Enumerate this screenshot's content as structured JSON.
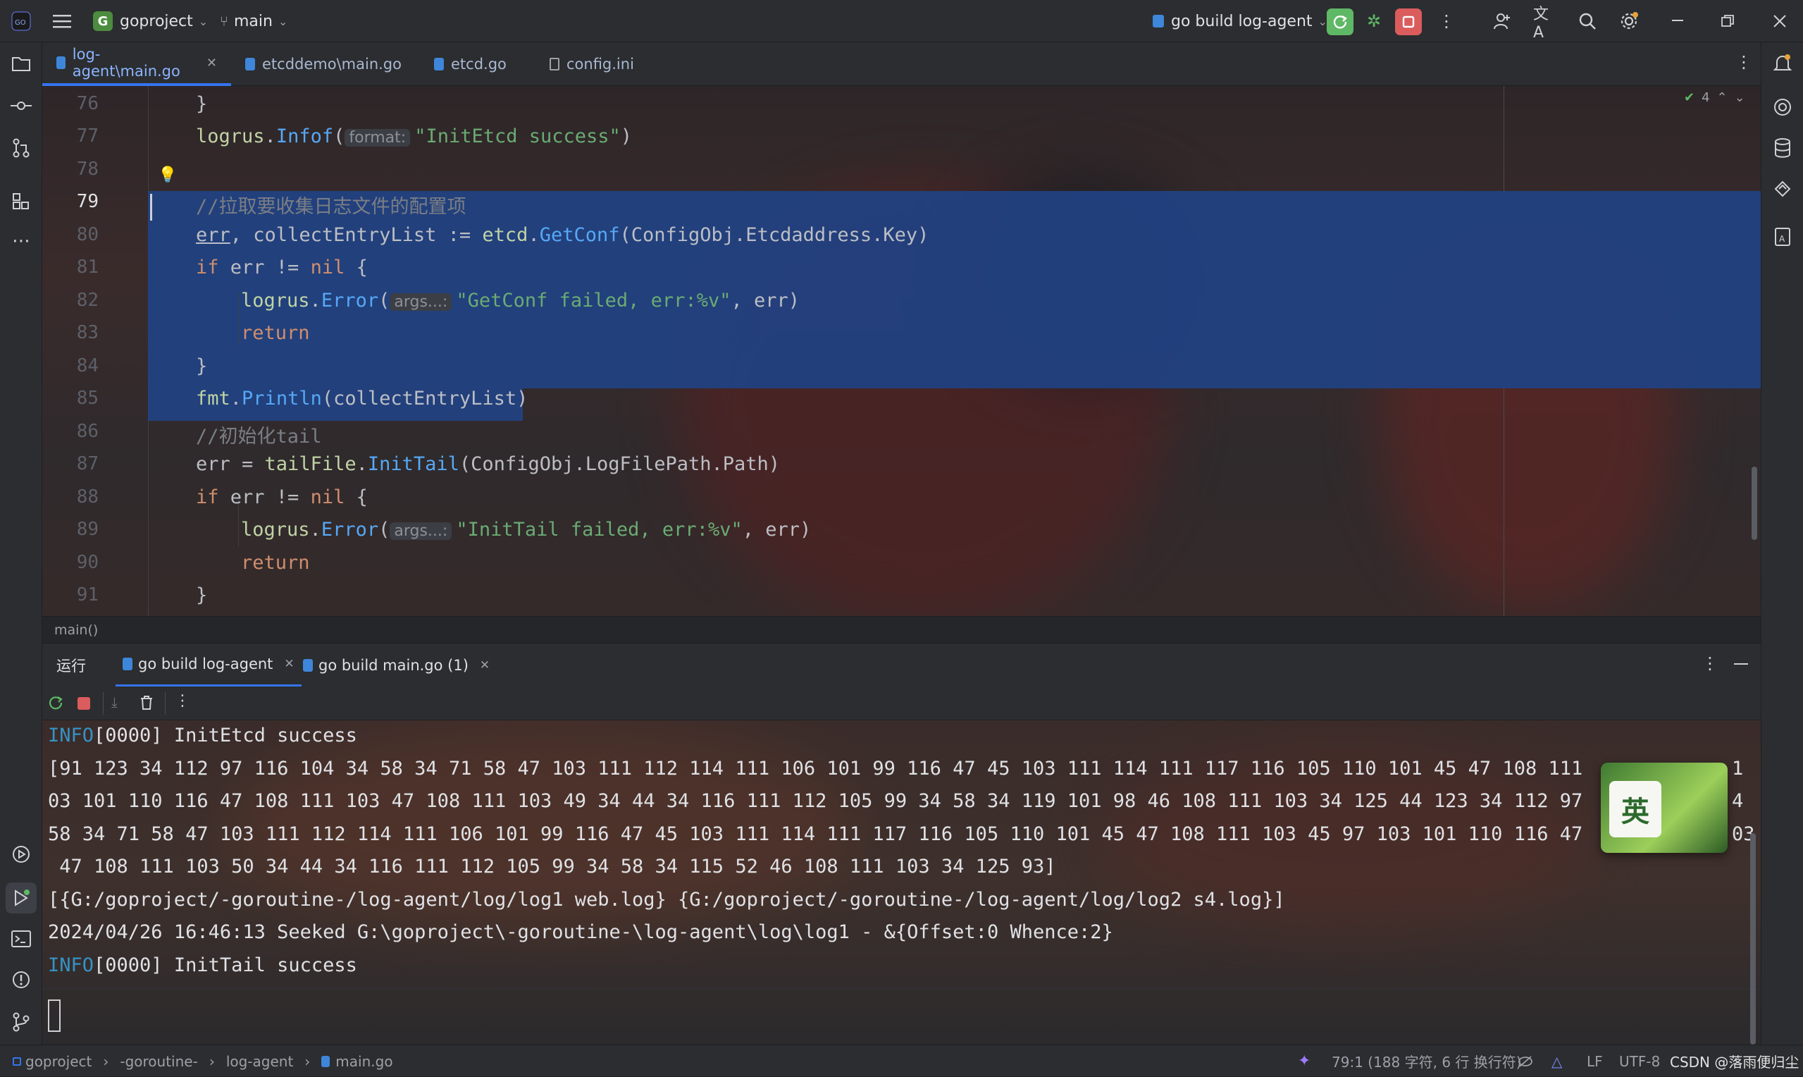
{
  "topbar": {
    "project_badge": "G",
    "project": "goproject",
    "branch": "main",
    "run_config": "go build log-agent"
  },
  "tabs": [
    {
      "label": "log-agent\\main.go",
      "active": true
    },
    {
      "label": "etcddemo\\main.go"
    },
    {
      "label": "etcd.go"
    },
    {
      "label": "config.ini"
    }
  ],
  "editor": {
    "inspection_count": "4",
    "lines": [
      {
        "n": "76"
      },
      {
        "n": "77"
      },
      {
        "n": "78"
      },
      {
        "n": "79"
      },
      {
        "n": "80"
      },
      {
        "n": "81"
      },
      {
        "n": "82"
      },
      {
        "n": "83"
      },
      {
        "n": "84"
      },
      {
        "n": "85"
      },
      {
        "n": "86"
      },
      {
        "n": "87"
      },
      {
        "n": "88"
      },
      {
        "n": "89"
      },
      {
        "n": "90"
      },
      {
        "n": "91"
      }
    ],
    "code": {
      "l76": "}",
      "l77_pkg": "logrus",
      "l77_fn": "Infof",
      "l77_hint": "format:",
      "l77_str": "\"InitEtcd success\"",
      "l79": "//拉取要收集日志文件的配置项",
      "l80_a": "err",
      "l80_b": ", collectEntryList := ",
      "l80_pkg": "etcd",
      "l80_fn": "GetConf",
      "l80_c": "(ConfigObj.Etcdaddress.Key)",
      "l81_kw": "if",
      "l81_a": " err != ",
      "l81_nil": "nil",
      "l81_b": " {",
      "l82_pkg": "logrus",
      "l82_fn": "Error",
      "l82_hint": "args...:",
      "l82_str": "\"GetConf failed, err:%v\"",
      "l82_tail": ", err)",
      "l83": "return",
      "l84": "}",
      "l85_pkg": "fmt",
      "l85_fn": "Println",
      "l85_a": "(collectEntryList)",
      "l86": "//初始化tail",
      "l87_a": "err = ",
      "l87_pkg": "tailFile",
      "l87_fn": "InitTail",
      "l87_b": "(ConfigObj.LogFilePath.Path)",
      "l88_kw": "if",
      "l88_a": " err != ",
      "l88_nil": "nil",
      "l88_b": " {",
      "l89_pkg": "logrus",
      "l89_fn": "Error",
      "l89_hint": "args...:",
      "l89_str": "\"InitTail failed, err:%v\"",
      "l89_tail": ", err)",
      "l90": "return",
      "l91": "}"
    }
  },
  "breadcrumb_func": "main()",
  "run_panel": {
    "title": "运行",
    "tabs": [
      {
        "label": "go build log-agent",
        "active": true
      },
      {
        "label": "go build main.go (1)"
      }
    ],
    "console": {
      "l1_level": "INFO",
      "l1_text": "[0000] InitEtcd success",
      "l2": "[91 123 34 112 97 116 104 34 58 34 71 58 47 103 111 112 114 111 106 101 99 116 47 45 103 111 114 111 117 116 105 110 101 45 47 108 111",
      "l2_tail": "1",
      "l3": "03 101 110 116 47 108 111 103 47 108 111 103 49 34 44 34 116 111 112 105 99 34 58 34 119 101 98 46 108 111 103 34 125 44 123 34 112 97",
      "l3_tail": "4",
      "l4": "58 34 71 58 47 103 111 112 114 111 106 101 99 116 47 45 103 111 114 111 117 116 105 110 101 45 47 108 111 103 45 97 103 101 110 116 47",
      "l4_tail": "03",
      "l5": " 47 108 111 103 50 34 44 34 116 111 112 105 99 34 58 34 115 52 46 108 111 103 34 125 93]",
      "l6": "[{G:/goproject/-goroutine-/log-agent/log/log1 web.log} {G:/goproject/-goroutine-/log-agent/log/log2 s4.log}]",
      "l7": "2024/04/26 16:46:13 Seeked G:\\goproject\\-goroutine-\\log-agent\\log\\log1 - &{Offset:0 Whence:2}",
      "l8_level": "INFO",
      "l8_text": "[0000] InitTail success"
    },
    "overlay_badge": "英"
  },
  "status": {
    "crumbs": [
      "goproject",
      "-goroutine-",
      "log-agent",
      "main.go"
    ],
    "position": "79:1 (188 字符, 6 行 换行符)",
    "line_sep": "LF",
    "encoding": "UTF-8",
    "watermark": "CSDN @落雨便归尘"
  },
  "colors": {
    "accent": "#3574f0",
    "selection": "#214283",
    "info": "#3592c4",
    "stop": "#db5c5c",
    "run_green": "#5fb865"
  }
}
